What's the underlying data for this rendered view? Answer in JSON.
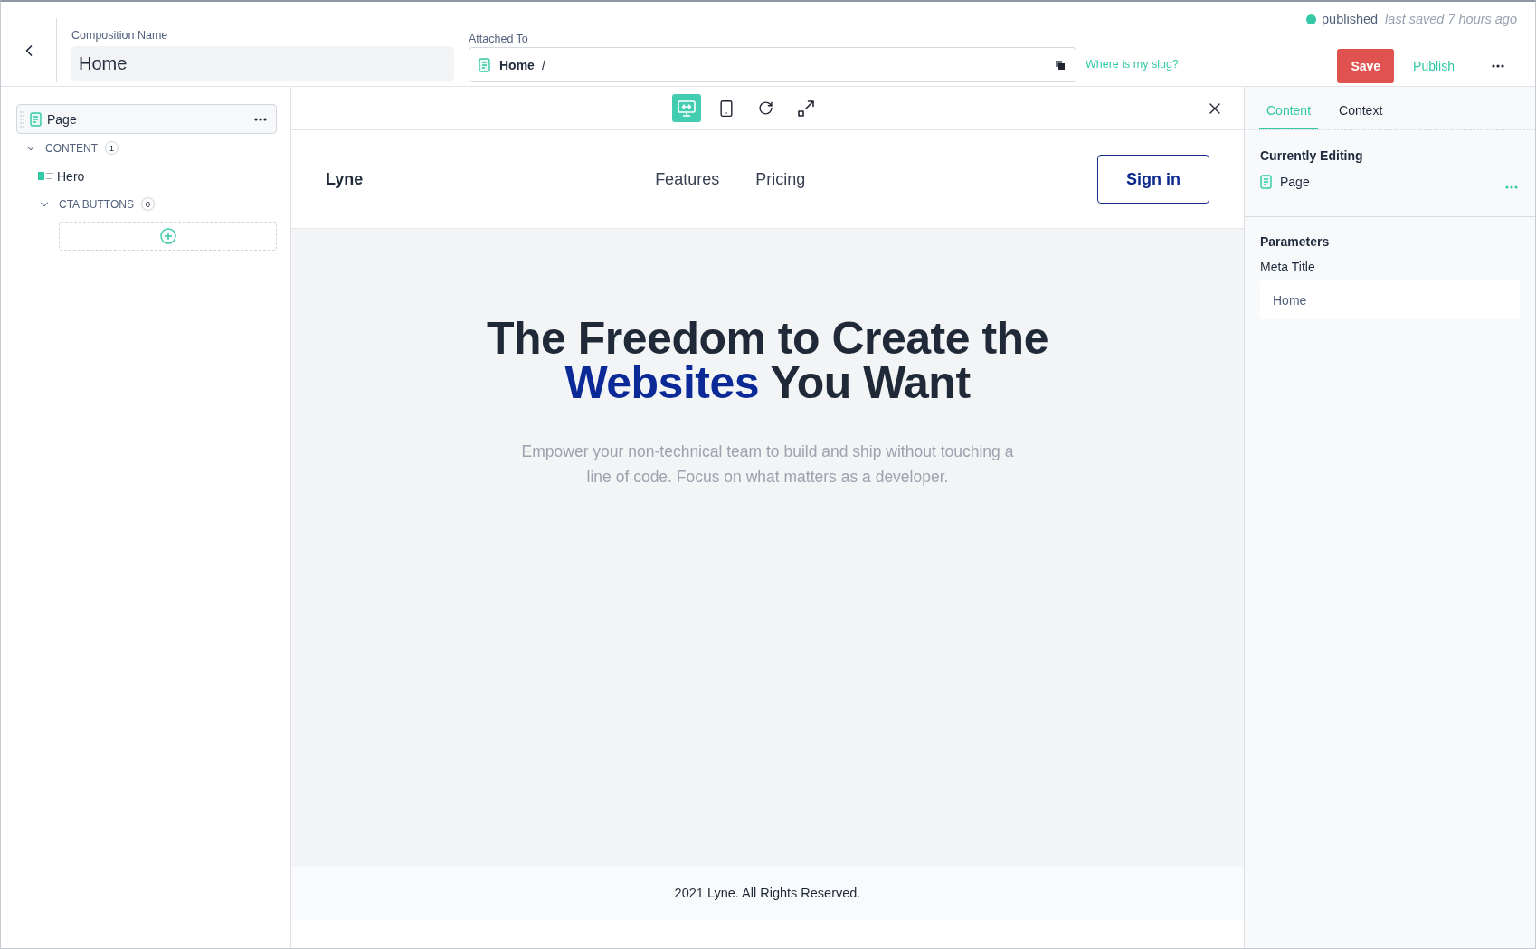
{
  "composition_name": {
    "label": "Composition Name",
    "value": "Home"
  },
  "attached_to": {
    "label": "Attached To",
    "page": "Home",
    "path": "/"
  },
  "slug_help_link": "Where is my slug?",
  "status": {
    "label": "published",
    "last_saved": "last saved 7 hours ago"
  },
  "actions": [
    {
      "label": "Save",
      "kind": "primary"
    },
    {
      "label": "Publish",
      "kind": "link"
    }
  ],
  "outline": {
    "label": "Page",
    "selected": true,
    "children": [
      {
        "kind": "slot",
        "label": "CONTENT",
        "count": "1",
        "expanded": true,
        "children": [
          {
            "kind": "component",
            "label": "Hero",
            "children": [
              {
                "kind": "slot",
                "label": "CTA BUTTONS",
                "count": "0",
                "expanded": true
              }
            ]
          }
        ]
      }
    ]
  },
  "preview_toolbar": {
    "devices": [
      {
        "kind": "desktop",
        "selected": true
      },
      {
        "kind": "mobile",
        "selected": false
      }
    ]
  },
  "preview": {
    "nav": {
      "logo": "Lyne",
      "links": [
        "Features",
        "Pricing"
      ],
      "button": "Sign in"
    },
    "hero": {
      "title": [
        {
          "text": "The Freedom to Create the",
          "highlight": false
        },
        {
          "text": "Websites",
          "highlight": true
        },
        {
          "text": "You Want",
          "highlight": false
        }
      ],
      "subtitle": "Empower your non-technical team to build and ship without touching a line of code. Focus on what matters as a developer."
    },
    "footer": "2021 Lyne. All Rights Reserved."
  },
  "inspector": {
    "tabs": [
      {
        "label": "Content",
        "selected": true
      },
      {
        "label": "Context",
        "selected": false
      }
    ],
    "currently_editing": {
      "heading": "Currently Editing",
      "item": "Page"
    },
    "parameters": {
      "heading": "Parameters",
      "fields": [
        {
          "label": "Meta Title",
          "value": "Home"
        }
      ]
    }
  }
}
